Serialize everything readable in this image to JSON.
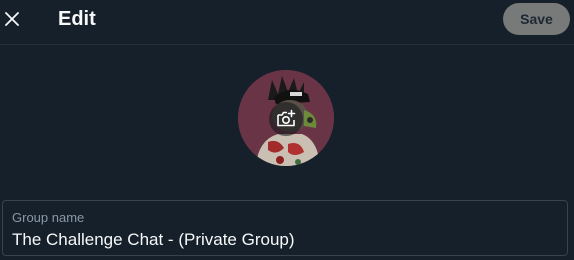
{
  "header": {
    "title": "Edit",
    "save_label": "Save",
    "close_icon": "close-icon"
  },
  "avatar": {
    "change_photo_icon": "camera-plus-icon"
  },
  "group_name": {
    "label": "Group name",
    "value": "The Challenge Chat - (Private Group)"
  },
  "colors": {
    "background": "#15202b",
    "text_primary": "#f7f9f9",
    "text_secondary": "#8b98a5",
    "save_button_disabled": "#787a7a",
    "border": "#38444d"
  }
}
